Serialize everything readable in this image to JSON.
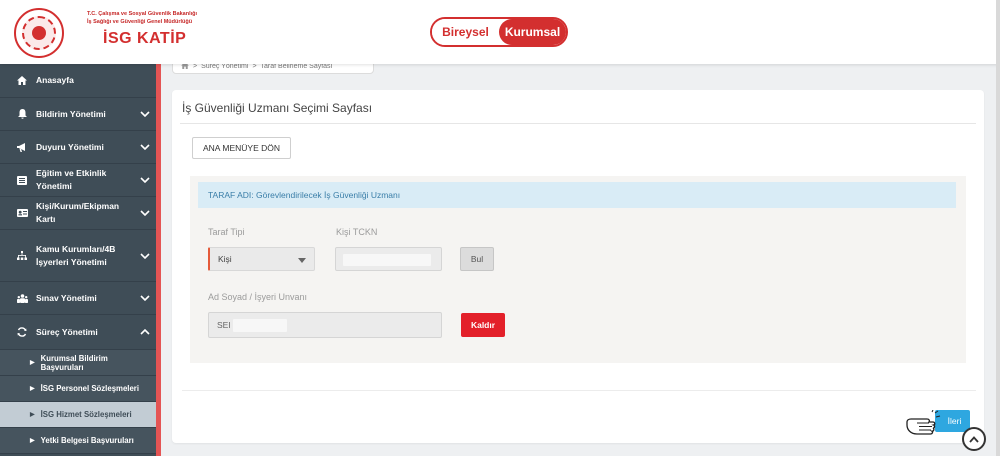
{
  "header": {
    "org_line_1": "T.C. Çalışma ve Sosyal Güvenlik Bakanlığı",
    "org_line_2": "İş Sağlığı ve Güvenliği Genel Müdürlüğü",
    "brand": "İSG KATİP",
    "toggle": [
      {
        "label": "Bireysel",
        "active": false
      },
      {
        "label": "Kurumsal",
        "active": true
      }
    ],
    "brand_color": "#d32f2f"
  },
  "sidebar": {
    "items": [
      {
        "icon": "home-icon",
        "label": "Anasayfa",
        "chevron": "none"
      },
      {
        "icon": "bell-icon",
        "label": "Bildirim Yönetimi",
        "chevron": "down"
      },
      {
        "icon": "megaphone-icon",
        "label": "Duyuru Yönetimi",
        "chevron": "down"
      },
      {
        "icon": "list-icon",
        "label": "Eğitim ve Etkinlik Yönetimi",
        "chevron": "down"
      },
      {
        "icon": "id-card-icon",
        "label": "Kişi/Kurum/Ekipman Kartı",
        "chevron": "down"
      },
      {
        "icon": "sitemap-icon",
        "label": "Kamu Kurumları/4B İşyerleri Yönetimi",
        "chevron": "down"
      },
      {
        "icon": "people-icon",
        "label": "Sınav Yönetimi",
        "chevron": "down"
      },
      {
        "icon": "refresh-icon",
        "label": "Süreç Yönetimi",
        "chevron": "up"
      }
    ],
    "subitems": [
      {
        "label": "Kurumsal Bildirim Başvuruları",
        "active": false
      },
      {
        "label": "İSG Personel Sözleşmeleri",
        "active": false
      },
      {
        "label": "İSG Hizmet Sözleşmeleri",
        "active": true
      },
      {
        "label": "Yetki Belgesi Başvuruları",
        "active": false
      }
    ]
  },
  "breadcrumb": {
    "items": [
      "Süreç Yönetimi",
      "Taraf Belirleme Sayfası"
    ],
    "separator": ">"
  },
  "main": {
    "title": "İş Güvenliği Uzmanı Seçimi Sayfası",
    "menu_button": "ANA MENÜYE DÖN",
    "panel_header": "TARAF ADI: Görevlendirilecek İş Güvenliği Uzmanı",
    "party_type_label": "Taraf Tipi",
    "party_type_value": "Kişi",
    "tckn_label": "Kişi TCKN",
    "tckn_value": "",
    "search_button": "Bul",
    "name_label": "Ad Soyad / İşyeri Unvanı",
    "name_value": "SEI",
    "remove_button": "Kaldır",
    "next_button": "İleri"
  }
}
